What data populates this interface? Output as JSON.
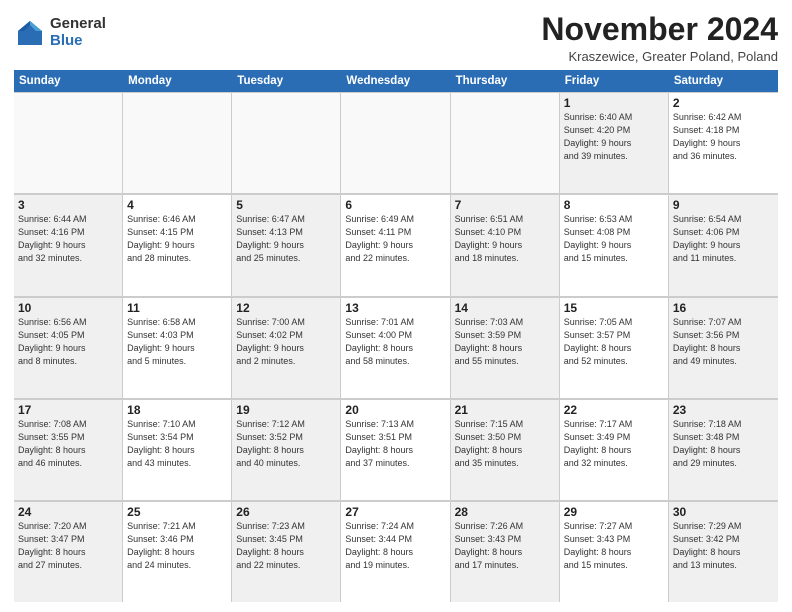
{
  "logo": {
    "general": "General",
    "blue": "Blue"
  },
  "title": "November 2024",
  "subtitle": "Kraszewice, Greater Poland, Poland",
  "headers": [
    "Sunday",
    "Monday",
    "Tuesday",
    "Wednesday",
    "Thursday",
    "Friday",
    "Saturday"
  ],
  "rows": [
    [
      {
        "day": "",
        "info": "",
        "empty": true
      },
      {
        "day": "",
        "info": "",
        "empty": true
      },
      {
        "day": "",
        "info": "",
        "empty": true
      },
      {
        "day": "",
        "info": "",
        "empty": true
      },
      {
        "day": "",
        "info": "",
        "empty": true
      },
      {
        "day": "1",
        "info": "Sunrise: 6:40 AM\nSunset: 4:20 PM\nDaylight: 9 hours\nand 39 minutes.",
        "shaded": true
      },
      {
        "day": "2",
        "info": "Sunrise: 6:42 AM\nSunset: 4:18 PM\nDaylight: 9 hours\nand 36 minutes.",
        "shaded": false
      }
    ],
    [
      {
        "day": "3",
        "info": "Sunrise: 6:44 AM\nSunset: 4:16 PM\nDaylight: 9 hours\nand 32 minutes.",
        "shaded": true
      },
      {
        "day": "4",
        "info": "Sunrise: 6:46 AM\nSunset: 4:15 PM\nDaylight: 9 hours\nand 28 minutes.",
        "shaded": false
      },
      {
        "day": "5",
        "info": "Sunrise: 6:47 AM\nSunset: 4:13 PM\nDaylight: 9 hours\nand 25 minutes.",
        "shaded": true
      },
      {
        "day": "6",
        "info": "Sunrise: 6:49 AM\nSunset: 4:11 PM\nDaylight: 9 hours\nand 22 minutes.",
        "shaded": false
      },
      {
        "day": "7",
        "info": "Sunrise: 6:51 AM\nSunset: 4:10 PM\nDaylight: 9 hours\nand 18 minutes.",
        "shaded": true
      },
      {
        "day": "8",
        "info": "Sunrise: 6:53 AM\nSunset: 4:08 PM\nDaylight: 9 hours\nand 15 minutes.",
        "shaded": false
      },
      {
        "day": "9",
        "info": "Sunrise: 6:54 AM\nSunset: 4:06 PM\nDaylight: 9 hours\nand 11 minutes.",
        "shaded": true
      }
    ],
    [
      {
        "day": "10",
        "info": "Sunrise: 6:56 AM\nSunset: 4:05 PM\nDaylight: 9 hours\nand 8 minutes.",
        "shaded": true
      },
      {
        "day": "11",
        "info": "Sunrise: 6:58 AM\nSunset: 4:03 PM\nDaylight: 9 hours\nand 5 minutes.",
        "shaded": false
      },
      {
        "day": "12",
        "info": "Sunrise: 7:00 AM\nSunset: 4:02 PM\nDaylight: 9 hours\nand 2 minutes.",
        "shaded": true
      },
      {
        "day": "13",
        "info": "Sunrise: 7:01 AM\nSunset: 4:00 PM\nDaylight: 8 hours\nand 58 minutes.",
        "shaded": false
      },
      {
        "day": "14",
        "info": "Sunrise: 7:03 AM\nSunset: 3:59 PM\nDaylight: 8 hours\nand 55 minutes.",
        "shaded": true
      },
      {
        "day": "15",
        "info": "Sunrise: 7:05 AM\nSunset: 3:57 PM\nDaylight: 8 hours\nand 52 minutes.",
        "shaded": false
      },
      {
        "day": "16",
        "info": "Sunrise: 7:07 AM\nSunset: 3:56 PM\nDaylight: 8 hours\nand 49 minutes.",
        "shaded": true
      }
    ],
    [
      {
        "day": "17",
        "info": "Sunrise: 7:08 AM\nSunset: 3:55 PM\nDaylight: 8 hours\nand 46 minutes.",
        "shaded": true
      },
      {
        "day": "18",
        "info": "Sunrise: 7:10 AM\nSunset: 3:54 PM\nDaylight: 8 hours\nand 43 minutes.",
        "shaded": false
      },
      {
        "day": "19",
        "info": "Sunrise: 7:12 AM\nSunset: 3:52 PM\nDaylight: 8 hours\nand 40 minutes.",
        "shaded": true
      },
      {
        "day": "20",
        "info": "Sunrise: 7:13 AM\nSunset: 3:51 PM\nDaylight: 8 hours\nand 37 minutes.",
        "shaded": false
      },
      {
        "day": "21",
        "info": "Sunrise: 7:15 AM\nSunset: 3:50 PM\nDaylight: 8 hours\nand 35 minutes.",
        "shaded": true
      },
      {
        "day": "22",
        "info": "Sunrise: 7:17 AM\nSunset: 3:49 PM\nDaylight: 8 hours\nand 32 minutes.",
        "shaded": false
      },
      {
        "day": "23",
        "info": "Sunrise: 7:18 AM\nSunset: 3:48 PM\nDaylight: 8 hours\nand 29 minutes.",
        "shaded": true
      }
    ],
    [
      {
        "day": "24",
        "info": "Sunrise: 7:20 AM\nSunset: 3:47 PM\nDaylight: 8 hours\nand 27 minutes.",
        "shaded": true
      },
      {
        "day": "25",
        "info": "Sunrise: 7:21 AM\nSunset: 3:46 PM\nDaylight: 8 hours\nand 24 minutes.",
        "shaded": false
      },
      {
        "day": "26",
        "info": "Sunrise: 7:23 AM\nSunset: 3:45 PM\nDaylight: 8 hours\nand 22 minutes.",
        "shaded": true
      },
      {
        "day": "27",
        "info": "Sunrise: 7:24 AM\nSunset: 3:44 PM\nDaylight: 8 hours\nand 19 minutes.",
        "shaded": false
      },
      {
        "day": "28",
        "info": "Sunrise: 7:26 AM\nSunset: 3:43 PM\nDaylight: 8 hours\nand 17 minutes.",
        "shaded": true
      },
      {
        "day": "29",
        "info": "Sunrise: 7:27 AM\nSunset: 3:43 PM\nDaylight: 8 hours\nand 15 minutes.",
        "shaded": false
      },
      {
        "day": "30",
        "info": "Sunrise: 7:29 AM\nSunset: 3:42 PM\nDaylight: 8 hours\nand 13 minutes.",
        "shaded": true
      }
    ]
  ]
}
